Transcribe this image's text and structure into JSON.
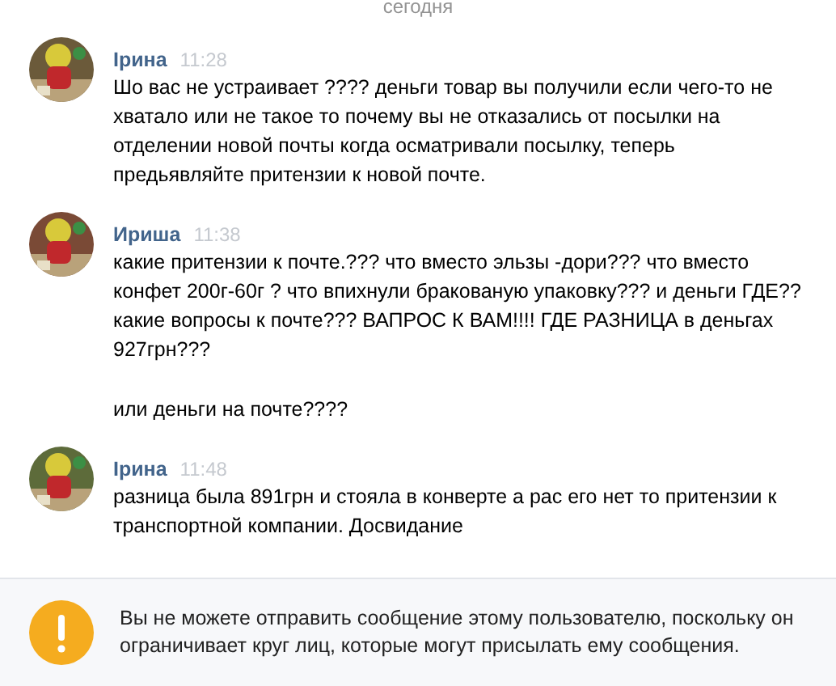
{
  "date_divider": "сегодня",
  "messages": [
    {
      "author": "Ірина",
      "time": "11:28",
      "avatar": {
        "kind": "picture"
      },
      "paragraphs": [
        "Шо вас не устраивает ???? деньги товар вы получили если чего-то не хватало или не такое то почему вы не отказались от посылки на отделении новой почты когда осматривали посылку, теперь предьявляйте притензии к новой почте."
      ]
    },
    {
      "author": "Ириша",
      "time": "11:38",
      "avatar": {
        "kind": "picture"
      },
      "paragraphs": [
        "какие притензии к почте.??? что вместо эльзы -дори??? что вместо конфет 200г-60г ? что впихнули бракованую упаковку??? и деньги ГДЕ?? какие вопросы к почте??? ВАПРОС К ВАМ!!!! ГДЕ РАЗНИЦА в деньгах 927грн???",
        "или деньги на почте????"
      ]
    },
    {
      "author": "Ірина",
      "time": "11:48",
      "avatar": {
        "kind": "picture"
      },
      "paragraphs": [
        "разница была 891грн и стояла в конверте а рас его нет то притензии к транспортной компании. Досвидание"
      ]
    }
  ],
  "notice": {
    "text": "Вы не можете отправить сообщение этому пользователю, поскольку он ограничивает круг лиц, которые могут присылать ему сообщения."
  }
}
